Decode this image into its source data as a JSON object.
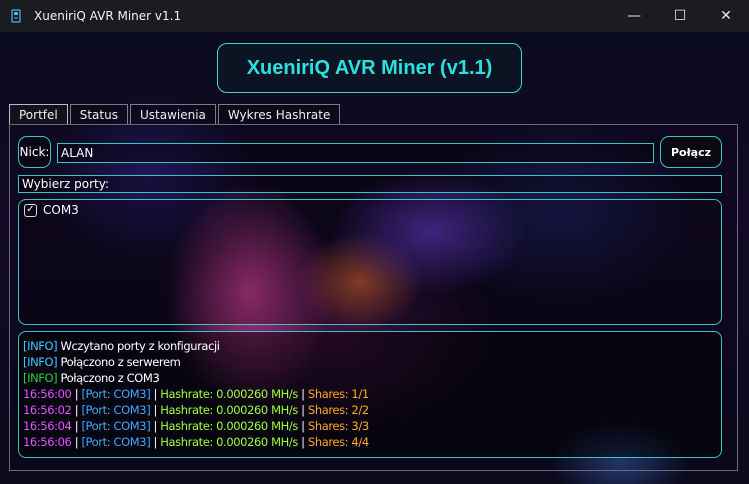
{
  "window": {
    "title": "XueniriQ AVR Miner v1.1",
    "controls": {
      "minimize": "—",
      "maximize": "☐",
      "close": "✕"
    }
  },
  "header": {
    "title": "XueniriQ AVR Miner (v1.1)"
  },
  "tabs": [
    {
      "label": "Portfel",
      "active": true
    },
    {
      "label": "Status",
      "active": false
    },
    {
      "label": "Ustawienia",
      "active": false
    },
    {
      "label": "Wykres Hashrate",
      "active": false
    }
  ],
  "wallet": {
    "nick_label": "Nick:",
    "nick_value": "ALAN",
    "connect_button": "Połącz",
    "ports_label": "Wybierz porty:",
    "ports": [
      {
        "name": "COM3",
        "checked": true
      }
    ]
  },
  "log": {
    "info_lines": [
      {
        "tag": "[INFO]",
        "text": "Wczytano porty z konfiguracji",
        "tag_color": "#40c9ff"
      },
      {
        "tag": "[INFO]",
        "text": "Połączono z serwerem",
        "tag_color": "#40c9ff"
      },
      {
        "tag": "[INFO]",
        "text": "Połączono z COM3",
        "tag_color": "#2ecc40"
      }
    ],
    "mining_lines": [
      {
        "time": "16:56:00",
        "port": "[Port: COM3]",
        "hashrate": "Hashrate: 0.000260 MH/s",
        "shares": "Shares: 1/1"
      },
      {
        "time": "16:56:02",
        "port": "[Port: COM3]",
        "hashrate": "Hashrate: 0.000260 MH/s",
        "shares": "Shares: 2/2"
      },
      {
        "time": "16:56:04",
        "port": "[Port: COM3]",
        "hashrate": "Hashrate: 0.000260 MH/s",
        "shares": "Shares: 3/3"
      },
      {
        "time": "16:56:06",
        "port": "[Port: COM3]",
        "hashrate": "Hashrate: 0.000260 MH/s",
        "shares": "Shares: 4/4"
      }
    ],
    "separator": " | "
  },
  "colors": {
    "accent": "#39c6c0",
    "header_text": "#2de0e0",
    "time": "#e455ff",
    "port": "#3fa9ff",
    "hashrate": "#9cff3c",
    "shares": "#ffa726"
  }
}
